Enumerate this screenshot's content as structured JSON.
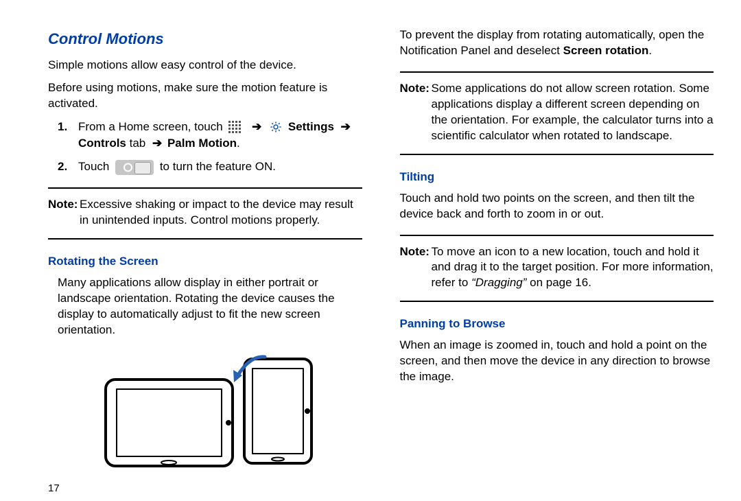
{
  "pageNumber": "17",
  "headings": {
    "controlMotions": "Control Motions",
    "rotating": "Rotating the Screen",
    "tilting": "Tilting",
    "panning": "Panning to Browse"
  },
  "paras": {
    "intro1": "Simple motions allow easy control of the device.",
    "intro2": "Before using motions, make sure the motion feature is activated.",
    "step1_a": "From a Home screen, touch ",
    "step1_b": " Settings ",
    "step1_c": "Controls",
    "step1_d": " tab ",
    "step1_e": " Palm Motion",
    "step2_a": "Touch ",
    "step2_b": " to turn the feature ON.",
    "note1": "Excessive shaking or impact to the device may result in unintended inputs. Control motions properly.",
    "rotatingBody": "Many applications allow display in either portrait or landscape orientation. Rotating the device causes the display to automatically adjust to fit the new screen orientation.",
    "rightTop_a": "To prevent the display from rotating automatically, open the Notification Panel and deselect ",
    "rightTop_b": "Screen rotation",
    "rightTop_c": ".",
    "note2": "Some applications do not allow screen rotation. Some applications display a different screen depending on the orientation. For example, the calculator turns into a scientific calculator when rotated to landscape.",
    "tiltBody": "Touch and hold two points on the screen, and then tilt the device back and forth to zoom in or out.",
    "note3_a": "To move an icon to a new location, touch and hold it and drag it to the target position. For more information, refer to ",
    "note3_b": "“Dragging”",
    "note3_c": " on page 16.",
    "panBody": "When an image is zoomed in, touch and hold a point on the screen, and then move the device in any direction to browse the image."
  },
  "labels": {
    "note": "Note:",
    "num1": "1.",
    "num2": "2.",
    "arrow": "➔"
  }
}
